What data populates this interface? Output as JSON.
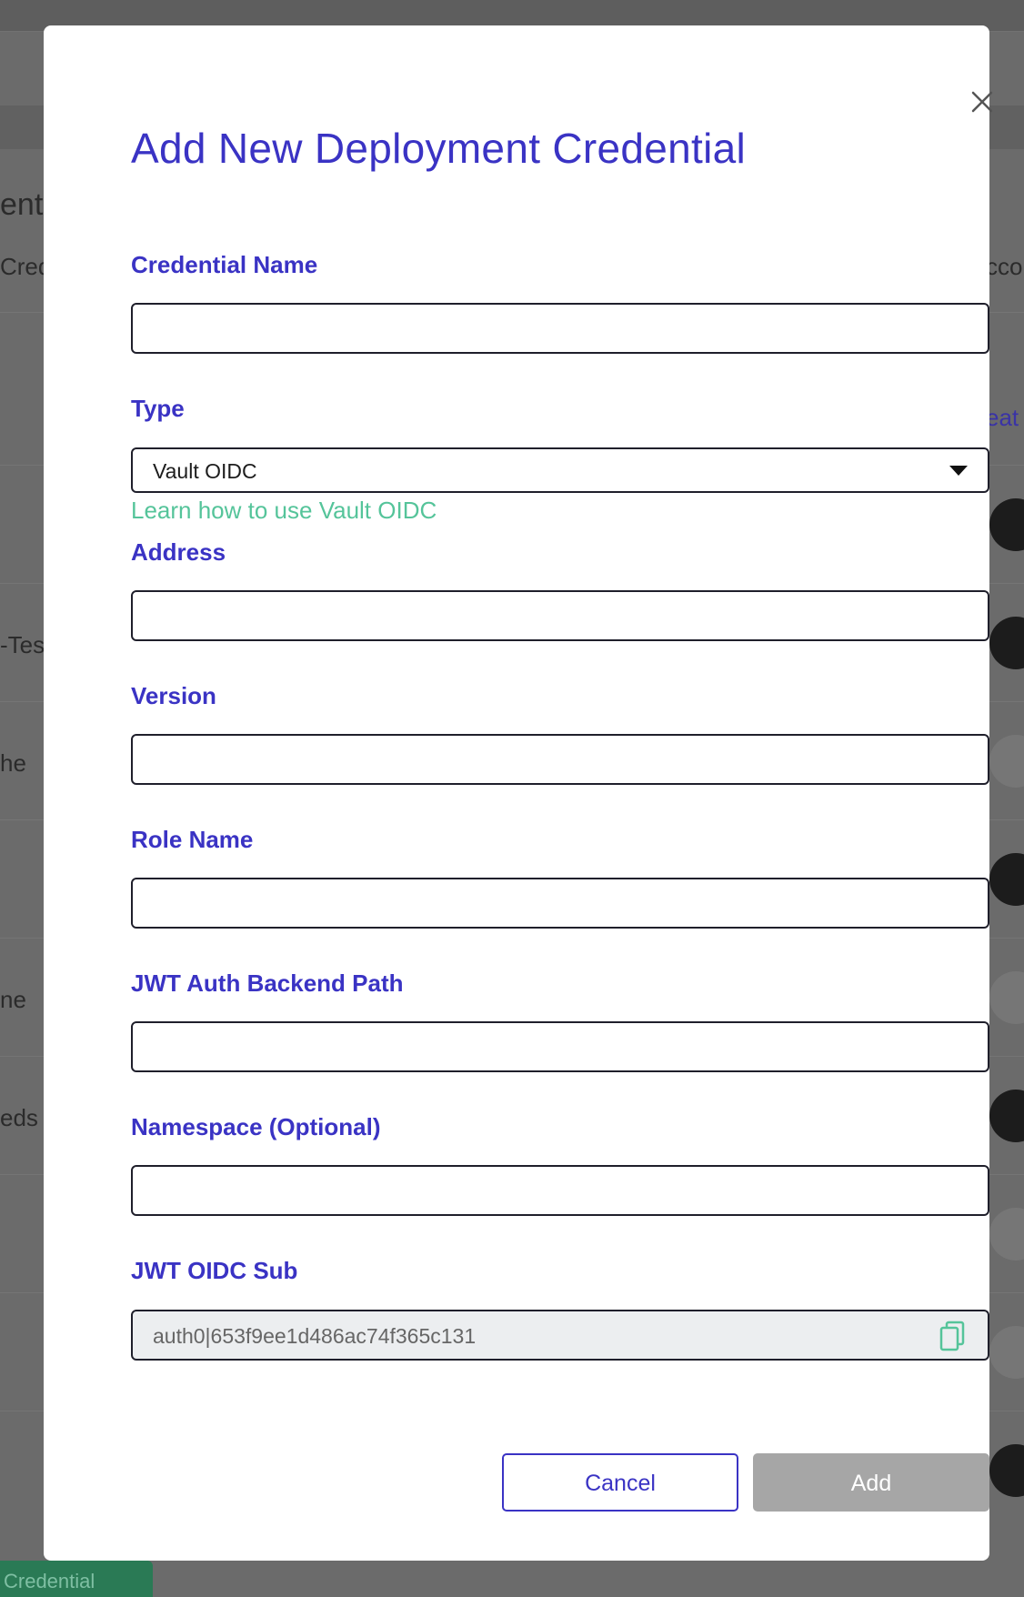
{
  "background": {
    "heading_fragment": "ent C",
    "column_fragment_left": "Crede",
    "column_fragment_right": "cco",
    "link_fragment": "eat",
    "row_fragments": [
      "-Tes",
      "he",
      "ne",
      "eds"
    ],
    "bottom_button_fragment": "Credential"
  },
  "modal": {
    "title": "Add New Deployment Credential",
    "close_icon": "close-icon",
    "fields": {
      "credential_name": {
        "label": "Credential Name",
        "value": "",
        "placeholder": ""
      },
      "type": {
        "label": "Type",
        "selected": "Vault OIDC",
        "help_link": "Learn how to use Vault OIDC"
      },
      "address": {
        "label": "Address",
        "value": "",
        "placeholder": ""
      },
      "version": {
        "label": "Version",
        "value": "",
        "placeholder": ""
      },
      "role_name": {
        "label": "Role Name",
        "value": "",
        "placeholder": ""
      },
      "jwt_auth_backend_path": {
        "label": "JWT Auth Backend Path",
        "value": "",
        "placeholder": ""
      },
      "namespace": {
        "label": "Namespace (Optional)",
        "value": "",
        "placeholder": ""
      },
      "jwt_oidc_sub": {
        "label": "JWT OIDC Sub",
        "value": "auth0|653f9ee1d486ac74f365c131",
        "copy_icon": "copy-icon"
      }
    },
    "buttons": {
      "cancel": "Cancel",
      "add": "Add"
    }
  },
  "colors": {
    "accent": "#3a33c4",
    "link": "#55c49a",
    "disabled_button": "#a6a6a6",
    "overlay": "#6b6b6b"
  }
}
